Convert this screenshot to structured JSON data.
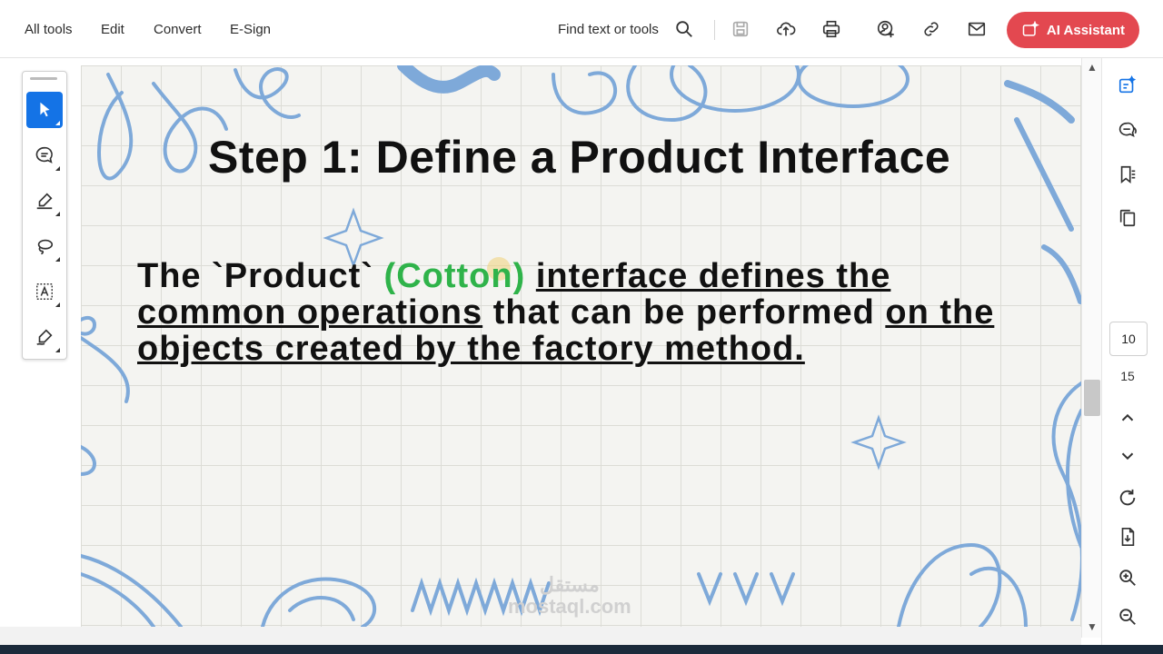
{
  "menu": {
    "items": [
      "All tools",
      "Edit",
      "Convert",
      "E-Sign"
    ]
  },
  "toolbar": {
    "find_label": "Find text or tools",
    "icons": [
      "search-icon",
      "save-icon",
      "upload-cloud-icon",
      "print-icon",
      "share-user-icon",
      "link-icon",
      "mail-icon"
    ],
    "ai_label": "AI Assistant",
    "ai_color": "#e34850"
  },
  "left_tools": [
    "select-pointer-icon",
    "comment-icon",
    "highlight-pen-icon",
    "lasso-icon",
    "text-box-icon",
    "sign-pen-icon"
  ],
  "document": {
    "title": "Step 1: Define a Product Interface",
    "para_prefix": "The `Product`",
    "para_green": "(Cotton)",
    "para_ul1": "interface defines the common operations",
    "para_mid": "that can be performed",
    "para_ul2": "on the objects created by the factory method.",
    "watermark_line1": "مستقل",
    "watermark_line2": "mostaql.com",
    "accent_green": "#2fb34a",
    "deco_blue": "#7ea9d9"
  },
  "right_rail": {
    "icons": [
      "edit-pdf-icon",
      "comments-icon",
      "bookmark-icon",
      "copy-pages-icon",
      "rotate-icon",
      "file-export-icon",
      "zoom-in-icon",
      "zoom-out-icon"
    ],
    "current_page": "10",
    "total_pages": "15"
  }
}
